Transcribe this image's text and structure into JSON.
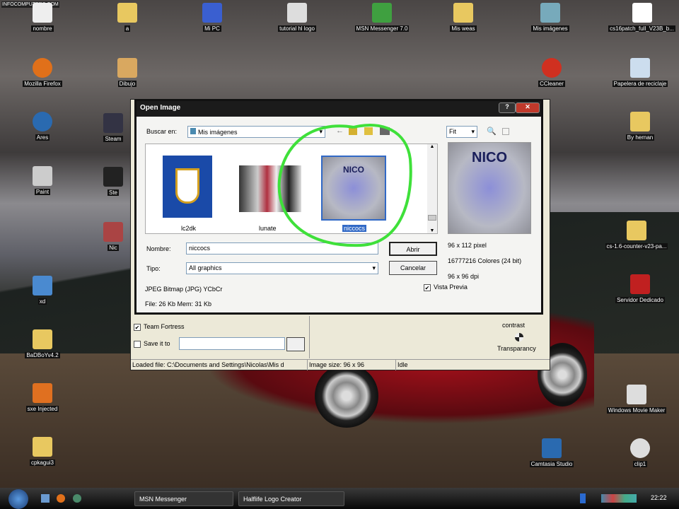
{
  "desktop": {
    "icons_top": [
      "nombre",
      "a",
      "Mi PC",
      "tutorial hl logo",
      "MSN Messenger 7.0",
      "Mis weas",
      "Mis imágenes",
      "cs16patch_full_V23B_b..."
    ],
    "icons_left": [
      "Mozilla Firefox",
      "Ares",
      "Paint",
      "xd",
      "BaDBoYv4.2",
      "sxe Injected",
      "cpkagui3"
    ],
    "icons_col2": [
      "Dibujo",
      "Steam",
      "Ste",
      "Nic"
    ],
    "icons_right": [
      "CCleaner",
      "Papelera de reciclaje",
      "By hernan",
      "cs-1.6-counter-v23-pa...",
      "Servidor Dedicado",
      "Windows Movie Maker",
      "Camtasia Studio",
      "clip1"
    ],
    "watermark": "INFOCOMPUTERS.COM"
  },
  "dialog": {
    "title": "Open Image",
    "look_in_label": "Buscar en:",
    "look_in_value": "Mis imágenes",
    "files": [
      {
        "name": "lc2dk"
      },
      {
        "name": "lunate"
      },
      {
        "name": "niccocs",
        "selected": true
      }
    ],
    "thumb_text": "NICO",
    "name_label": "Nombre:",
    "name_value": "niccocs",
    "type_label": "Tipo:",
    "type_value": "All graphics",
    "open_button": "Abrir",
    "cancel_button": "Cancelar",
    "format_info": "JPEG Bitmap (JPG) YCbCr",
    "size_info": "File: 26 Kb   Mem: 31 Kb",
    "fit_value": "Fit",
    "preview_dims": "96 x 112 pixel",
    "preview_colors": "16777216 Colores (24 bit)",
    "preview_dpi": "96 x 96 dpi",
    "preview_checkbox": "Vista Previa"
  },
  "app": {
    "team_fortress": "Team Fortress",
    "save_it_to": "Save it to",
    "contrast": "contrast",
    "transparency": "Transparancy",
    "status_loaded": "Loaded file: C:\\Documents and Settings\\Nicolas\\Mis d",
    "status_size": "Image size: 96 x 96",
    "status_state": "Idle"
  },
  "taskbar": {
    "items": [
      "MSN Messenger",
      "Halflife Logo Creator"
    ],
    "clock": "22:22"
  },
  "colors": {
    "annotation": "#3fe03a",
    "selection": "#3169c6"
  }
}
